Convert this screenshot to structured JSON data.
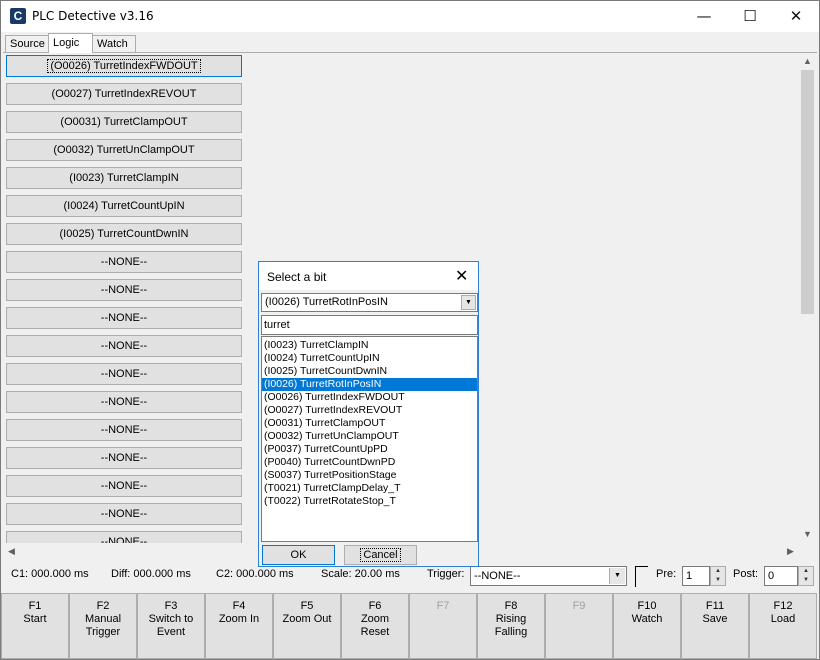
{
  "window": {
    "title": "PLC Detective v3.16",
    "app_icon": "C"
  },
  "tabs": [
    "Source",
    "Logic",
    "Watch"
  ],
  "signals": [
    "(O0026) TurretIndexFWDOUT",
    "(O0027) TurretIndexREVOUT",
    "(O0031) TurretClampOUT",
    "(O0032) TurretUnClampOUT",
    "(I0023) TurretClampIN",
    "(I0024) TurretCountUpIN",
    "(I0025) TurretCountDwnIN",
    "--NONE--",
    "--NONE--",
    "--NONE--",
    "--NONE--",
    "--NONE--",
    "--NONE--",
    "--NONE--",
    "--NONE--",
    "--NONE--",
    "--NONE--",
    "--NONE--"
  ],
  "info": {
    "c1": "C1: 000.000 ms",
    "diff": "Diff: 000.000 ms",
    "c2": "C2: 000.000 ms",
    "scale": "Scale: 20.00 ms",
    "trigger_label": "Trigger:",
    "trigger_value": "--NONE--",
    "pre_label": "Pre:",
    "pre_value": "1",
    "post_label": "Post:",
    "post_value": "0"
  },
  "fkeys": [
    {
      "key": "F1",
      "label": "Start"
    },
    {
      "key": "F2",
      "label": "Manual Trigger"
    },
    {
      "key": "F3",
      "label": "Switch to Event"
    },
    {
      "key": "F4",
      "label": "Zoom In"
    },
    {
      "key": "F5",
      "label": "Zoom Out"
    },
    {
      "key": "F6",
      "label": "Zoom Reset"
    },
    {
      "key": "F7",
      "label": ""
    },
    {
      "key": "F8",
      "label": "Rising Falling"
    },
    {
      "key": "F9",
      "label": ""
    },
    {
      "key": "F10",
      "label": "Watch"
    },
    {
      "key": "F11",
      "label": "Save"
    },
    {
      "key": "F12",
      "label": "Load"
    }
  ],
  "dialog": {
    "title": "Select a bit",
    "combo_value": "(I0026) TurretRotInPosIN",
    "filter_text": "turret",
    "items": [
      "(I0023) TurretClampIN",
      "(I0024) TurretCountUpIN",
      "(I0025) TurretCountDwnIN",
      "(I0026) TurretRotInPosIN",
      "(O0026) TurretIndexFWDOUT",
      "(O0027) TurretIndexREVOUT",
      "(O0031) TurretClampOUT",
      "(O0032) TurretUnClampOUT",
      "(P0037) TurretCountUpPD",
      "(P0040) TurretCountDwnPD",
      "(S0037) TurretPositionStage",
      "(T0021) TurretClampDelay_T",
      "(T0022) TurretRotateStop_T"
    ],
    "selected_index": 3,
    "ok_label": "OK",
    "cancel_label": "Cancel"
  },
  "colors": {
    "accent": "#0078d7",
    "window_bg": "#f0f0f0",
    "button_bg": "#e1e1e1"
  }
}
